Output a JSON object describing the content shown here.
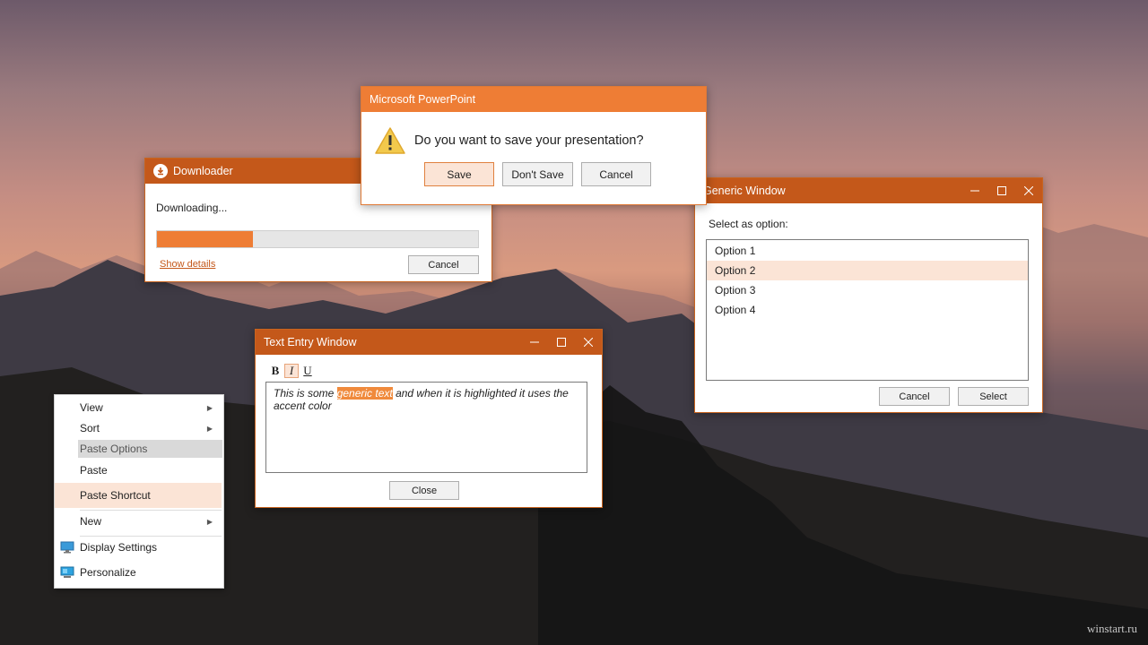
{
  "colors": {
    "accent": "#c4581a",
    "accent_light": "#ee7d35",
    "highlight": "#fbe4d6",
    "selection": "#f08a3c"
  },
  "downloader": {
    "title": "Downloader",
    "status": "Downloading...",
    "progress": 0.3,
    "show_details": "Show details",
    "cancel": "Cancel"
  },
  "powerpoint": {
    "title": "Microsoft  PowerPoint",
    "message": "Do you want to save your presentation?",
    "save": "Save",
    "dont_save": "Don't Save",
    "cancel": "Cancel"
  },
  "generic": {
    "title": "Generic Window",
    "prompt": "Select as option:",
    "options": [
      "Option 1",
      "Option 2",
      "Option 3",
      "Option 4"
    ],
    "selected_index": 1,
    "cancel": "Cancel",
    "select": "Select"
  },
  "textentry": {
    "title": "Text Entry  Window",
    "bold": "B",
    "italic": "I",
    "underline": "U",
    "text_before": "This is some ",
    "text_selected": "generic text",
    "text_after": " and when it is highlighted it uses the accent color",
    "close": "Close"
  },
  "context_menu": {
    "items": [
      {
        "label": "View",
        "submenu": true
      },
      {
        "label": "Sort",
        "submenu": true
      },
      {
        "label": "Paste Options",
        "submenu": false
      },
      {
        "label": "Paste",
        "submenu": false
      },
      {
        "label": "Paste Shortcut",
        "submenu": false
      },
      {
        "label": "New",
        "submenu": true
      },
      {
        "label": "Display Settings",
        "submenu": false
      },
      {
        "label": "Personalize",
        "submenu": false
      }
    ]
  },
  "watermark": "winstart.ru"
}
